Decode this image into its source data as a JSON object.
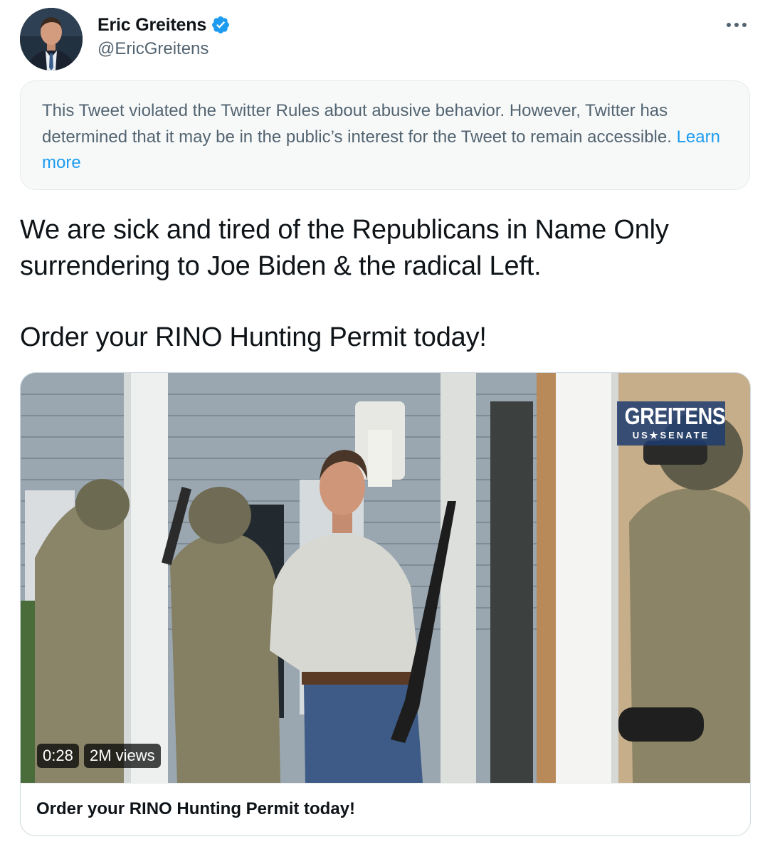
{
  "author": {
    "display_name": "Eric Greitens",
    "handle": "@EricGreitens",
    "verified": true,
    "avatar_icon": "profile-photo"
  },
  "more_icon": "more-dots-icon",
  "notice": {
    "text": "This Tweet violated the Twitter Rules about abusive behavior. However, Twitter has determined that it may be in the public’s interest for the Tweet to remain accessible.",
    "link_label": "Learn more"
  },
  "tweet": {
    "line1": "We are sick and tired of the Republicans in Name Only surrendering to Joe Biden & the radical Left.",
    "line2": "Order your RINO Hunting Permit today!"
  },
  "media": {
    "duration": "0:28",
    "views": "2M views",
    "overlay_logo": "GREITENS",
    "overlay_logo_sub": "US★SENATE",
    "caption": "Order your RINO Hunting Permit today!"
  },
  "colors": {
    "link": "#1d9bf0",
    "verified_badge": "#1d9bf0",
    "secondary_text": "#536471",
    "notice_bg": "#f7f9f9"
  }
}
